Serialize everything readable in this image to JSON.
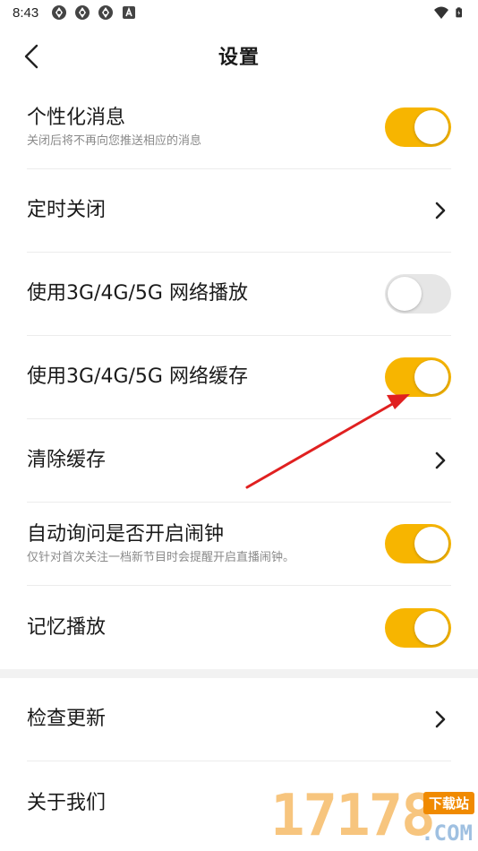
{
  "status_bar": {
    "time": "8:43",
    "left_icons": [
      "app-notification-icon",
      "app-notification-icon",
      "app-notification-icon",
      "accessibility-a-icon"
    ],
    "right_icons": [
      "wifi-icon",
      "battery-icon"
    ]
  },
  "nav": {
    "back_icon": "chevron-left-icon",
    "title": "设置"
  },
  "settings_group_1": [
    {
      "id": "personalized-messages",
      "title": "个性化消息",
      "subtitle": "关闭后将不再向您推送相应的消息",
      "control": "toggle",
      "on": true
    },
    {
      "id": "timer-close",
      "title": "定时关闭",
      "control": "chevron"
    },
    {
      "id": "mobile-network-play",
      "title": "使用3G/4G/5G 网络播放",
      "control": "toggle",
      "on": false
    },
    {
      "id": "mobile-network-cache",
      "title": "使用3G/4G/5G 网络缓存",
      "control": "toggle",
      "on": true
    },
    {
      "id": "clear-cache",
      "title": "清除缓存",
      "control": "chevron"
    },
    {
      "id": "auto-alarm-ask",
      "title": "自动询问是否开启闹钟",
      "subtitle": "仅针对首次关注一档新节目时会提醒开启直播闹钟。",
      "control": "toggle",
      "on": true
    },
    {
      "id": "memory-playback",
      "title": "记忆播放",
      "control": "toggle",
      "on": true
    }
  ],
  "settings_group_2": [
    {
      "id": "check-update",
      "title": "检查更新",
      "control": "chevron"
    },
    {
      "id": "about-us",
      "title": "关于我们",
      "control": "chevron"
    }
  ],
  "colors": {
    "toggle_on": "#f7b500",
    "toggle_off": "#e6e6e6",
    "annotation_arrow": "#e02020",
    "section_band": "#f2f2f2"
  },
  "watermark": {
    "digits": "17178",
    "tag": "下载站",
    "domain": ".COM"
  }
}
